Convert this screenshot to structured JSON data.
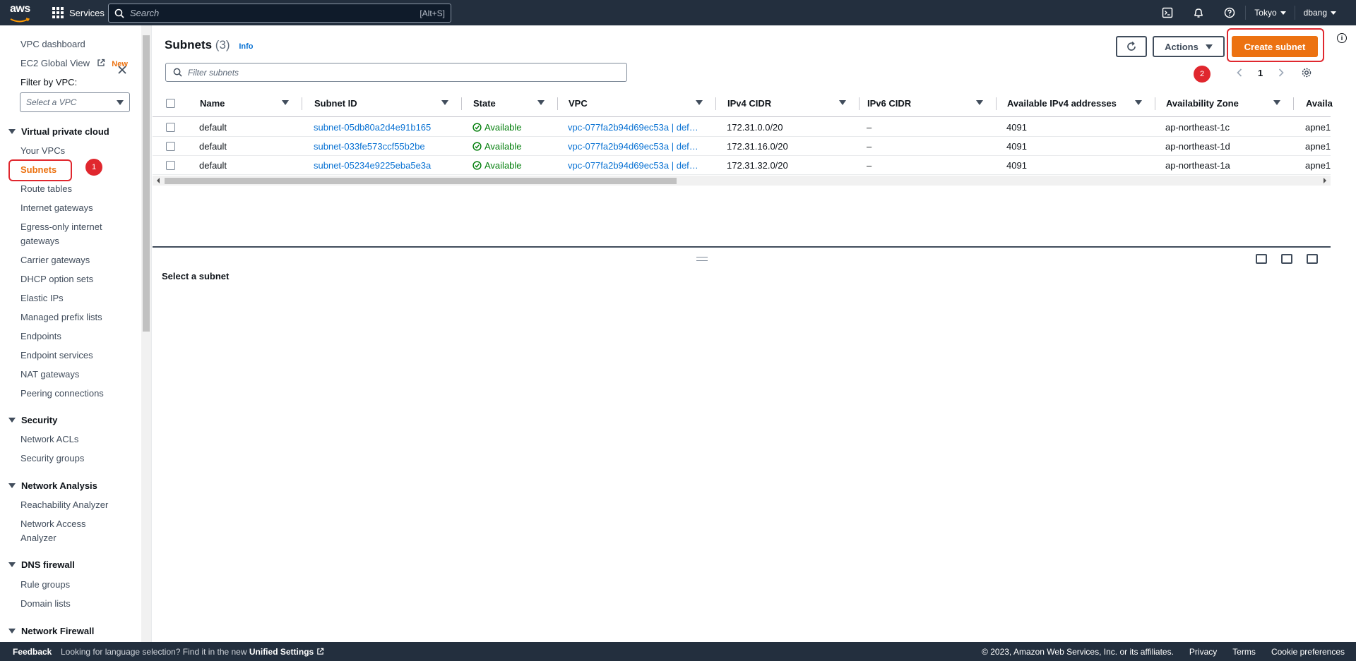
{
  "topnav": {
    "logo_text": "aws",
    "services_label": "Services",
    "search_placeholder": "Search",
    "search_shortcut": "[Alt+S]",
    "region_label": "Tokyo",
    "user_label": "dbang"
  },
  "sidebar": {
    "dashboard_label": "VPC dashboard",
    "ec2_global_view_label": "EC2 Global View",
    "new_badge": "New",
    "filter_label": "Filter by VPC:",
    "vpc_select_placeholder": "Select a VPC",
    "sections": {
      "vpc": "Virtual private cloud",
      "security": "Security",
      "network_analysis": "Network Analysis",
      "dns_firewall": "DNS firewall",
      "network_firewall": "Network Firewall"
    },
    "items": {
      "your_vpcs": "Your VPCs",
      "subnets": "Subnets",
      "route_tables": "Route tables",
      "internet_gateways": "Internet gateways",
      "egress_line1": "Egress-only internet",
      "egress_line2": "gateways",
      "carrier_gateways": "Carrier gateways",
      "dhcp_option_sets": "DHCP option sets",
      "elastic_ips": "Elastic IPs",
      "managed_prefix_lists": "Managed prefix lists",
      "endpoints": "Endpoints",
      "endpoint_services": "Endpoint services",
      "nat_gateways": "NAT gateways",
      "peering_connections": "Peering connections",
      "network_acls": "Network ACLs",
      "security_groups": "Security groups",
      "reachability_analyzer": "Reachability Analyzer",
      "network_access_line1": "Network Access",
      "network_access_line2": "Analyzer",
      "rule_groups": "Rule groups",
      "domain_lists": "Domain lists"
    }
  },
  "annotations": {
    "badge1": "1",
    "badge2": "2"
  },
  "main": {
    "title": "Subnets",
    "count": "(3)",
    "info_link": "Info",
    "actions_label": "Actions",
    "create_label": "Create subnet",
    "filter_placeholder": "Filter subnets",
    "page_number": "1",
    "columns": {
      "name": "Name",
      "subnet_id": "Subnet ID",
      "state": "State",
      "vpc": "VPC",
      "ipv4_cidr": "IPv4 CIDR",
      "ipv6_cidr": "IPv6 CIDR",
      "available_ipv4": "Available IPv4 addresses",
      "az": "Availability Zone",
      "az_id": "Availa"
    },
    "rows": [
      {
        "name": "default",
        "subnet_id": "subnet-05db80a2d4e91b165",
        "state": "Available",
        "vpc": "vpc-077fa2b94d69ec53a | def…",
        "ipv4": "172.31.0.0/20",
        "ipv6": "–",
        "available": "4091",
        "az": "ap-northeast-1c",
        "az_id": "apne1"
      },
      {
        "name": "default",
        "subnet_id": "subnet-033fe573ccf55b2be",
        "state": "Available",
        "vpc": "vpc-077fa2b94d69ec53a | def…",
        "ipv4": "172.31.16.0/20",
        "ipv6": "–",
        "available": "4091",
        "az": "ap-northeast-1d",
        "az_id": "apne1"
      },
      {
        "name": "default",
        "subnet_id": "subnet-05234e9225eba5e3a",
        "state": "Available",
        "vpc": "vpc-077fa2b94d69ec53a | def…",
        "ipv4": "172.31.32.0/20",
        "ipv6": "–",
        "available": "4091",
        "az": "ap-northeast-1a",
        "az_id": "apne1"
      }
    ],
    "detail_message": "Select a subnet"
  },
  "footer": {
    "feedback": "Feedback",
    "lang_text": "Looking for language selection? Find it in the new",
    "unified_settings": "Unified Settings",
    "copyright": "© 2023, Amazon Web Services, Inc. or its affiliates.",
    "privacy": "Privacy",
    "terms": "Terms",
    "cookie": "Cookie preferences"
  },
  "colors": {
    "nav_bg": "#232f3e",
    "accent": "#ec7211",
    "link": "#0972d3",
    "success": "#037f0c",
    "annotation_red": "#e0272e"
  }
}
